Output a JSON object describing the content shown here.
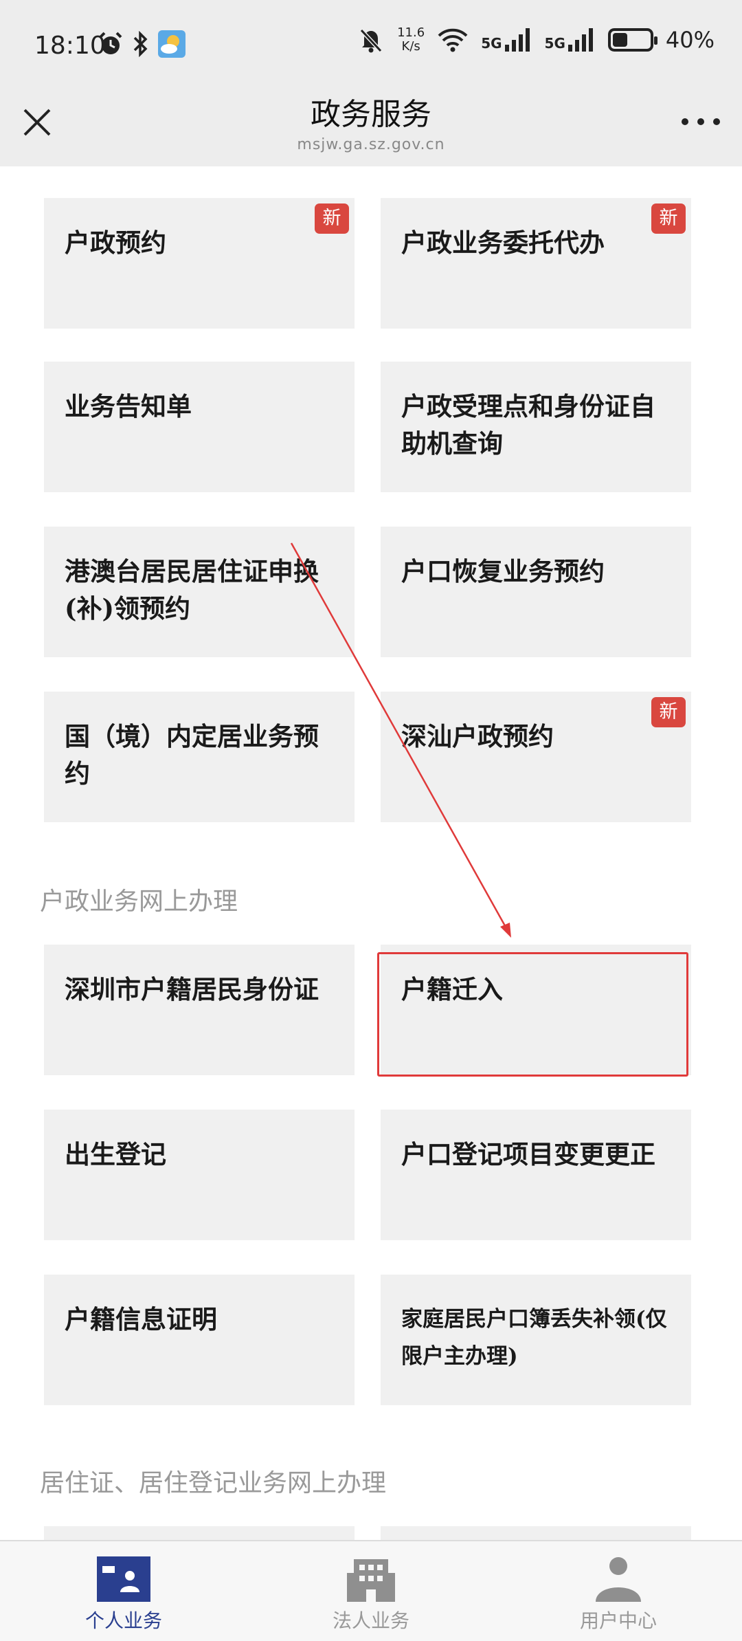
{
  "status_bar": {
    "time": "18:10",
    "net_speed_value": "11.6",
    "net_speed_unit": "K/s",
    "signal1": "5G",
    "signal2": "5G",
    "battery_percent": "40%",
    "battery_level": 0.4,
    "icons": [
      "alarm-icon",
      "bluetooth-icon",
      "weather-icon",
      "mute-icon",
      "wifi-icon",
      "signal-icon",
      "battery-icon"
    ]
  },
  "header": {
    "title": "政务服务",
    "url": "msjw.ga.sz.gov.cn"
  },
  "badge_text": "新",
  "group1": {
    "cards": [
      {
        "label": "户政预约",
        "badge": true
      },
      {
        "label": "户政业务委托代办",
        "badge": true
      },
      {
        "label": "业务告知单",
        "badge": false
      },
      {
        "label": "户政受理点和身份证自助机查询",
        "badge": false
      },
      {
        "label": "港澳台居民居住证申换(补)领预约",
        "badge": false
      },
      {
        "label": "户口恢复业务预约",
        "badge": false
      },
      {
        "label": "国（境）内定居业务预约",
        "badge": false
      },
      {
        "label": "深汕户政预约",
        "badge": true
      }
    ]
  },
  "section2": {
    "title": "户政业务网上办理",
    "cards": [
      {
        "label": "深圳市户籍居民身份证"
      },
      {
        "label": "户籍迁入"
      },
      {
        "label": "出生登记"
      },
      {
        "label": "户口登记项目变更更正"
      },
      {
        "label": "户籍信息证明"
      },
      {
        "label": "家庭居民户口簿丢失补领(仅限户主办理)"
      }
    ]
  },
  "section3": {
    "title": "居住证、居住登记业务网上办理"
  },
  "bottom_nav": {
    "items": [
      {
        "label": "个人业务",
        "active": true
      },
      {
        "label": "法人业务",
        "active": false
      },
      {
        "label": "用户中心",
        "active": false
      }
    ]
  },
  "colors": {
    "accent": "#2a3f8f",
    "badge": "#d9473f",
    "highlight": "#e03a3a",
    "card_bg": "#f0f0f0"
  }
}
